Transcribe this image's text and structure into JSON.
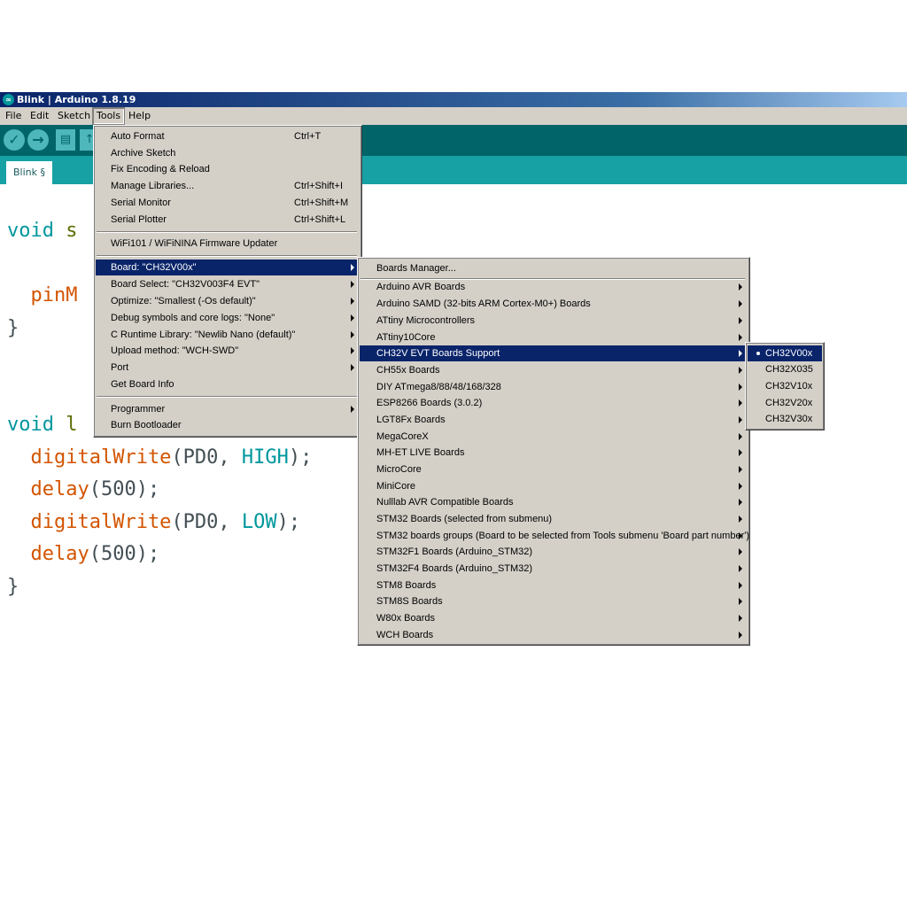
{
  "window": {
    "title": "Blink | Arduino 1.8.19",
    "icon": "arduino-infinity-icon"
  },
  "menubar": [
    {
      "label": "File"
    },
    {
      "label": "Edit"
    },
    {
      "label": "Sketch"
    },
    {
      "label": "Tools"
    },
    {
      "label": "Help"
    }
  ],
  "toolbar": {
    "verify": "verify-icon",
    "upload": "upload-icon",
    "new": "new-icon",
    "open": "open-icon"
  },
  "tab": {
    "label": "Blink §"
  },
  "code": {
    "l1_a": "void",
    "l1_b": " s",
    "l2_a": "  pinM",
    "l3": "}",
    "l4_a": "void",
    "l4_b": " l",
    "l5_a": "  digitalWrite",
    "l5_b": "(PD0, ",
    "l5_c": "HIGH",
    "l5_d": ");",
    "l6_a": "  delay",
    "l6_b": "(500);",
    "l7_a": "  digitalWrite",
    "l7_b": "(PD0, ",
    "l7_c": "LOW",
    "l7_d": ");",
    "l8_a": "  delay",
    "l8_b": "(500);",
    "l9": "}"
  },
  "tools_menu": {
    "items": [
      {
        "label": "Auto Format",
        "shortcut": "Ctrl+T"
      },
      {
        "label": "Archive Sketch",
        "shortcut": ""
      },
      {
        "label": "Fix Encoding & Reload",
        "shortcut": ""
      },
      {
        "label": "Manage Libraries...",
        "shortcut": "Ctrl+Shift+I"
      },
      {
        "label": "Serial Monitor",
        "shortcut": "Ctrl+Shift+M"
      },
      {
        "label": "Serial Plotter",
        "shortcut": "Ctrl+Shift+L"
      },
      {
        "label": "WiFi101 / WiFiNINA Firmware Updater",
        "shortcut": ""
      },
      {
        "label": "Board: \"CH32V00x\"",
        "shortcut": ""
      },
      {
        "label": "Board Select: \"CH32V003F4 EVT\"",
        "shortcut": ""
      },
      {
        "label": "Optimize: \"Smallest (-Os default)\"",
        "shortcut": ""
      },
      {
        "label": "Debug symbols and core logs: \"None\"",
        "shortcut": ""
      },
      {
        "label": "C Runtime Library: \"Newlib Nano (default)\"",
        "shortcut": ""
      },
      {
        "label": "Upload method: \"WCH-SWD\"",
        "shortcut": ""
      },
      {
        "label": "Port",
        "shortcut": ""
      },
      {
        "label": "Get Board Info",
        "shortcut": ""
      },
      {
        "label": "Programmer",
        "shortcut": ""
      },
      {
        "label": "Burn Bootloader",
        "shortcut": ""
      }
    ]
  },
  "board_menu": {
    "items": [
      {
        "label": "Boards Manager..."
      },
      {
        "label": "Arduino AVR Boards"
      },
      {
        "label": "Arduino SAMD (32-bits ARM Cortex-M0+) Boards"
      },
      {
        "label": "ATtiny Microcontrollers"
      },
      {
        "label": "ATtiny10Core"
      },
      {
        "label": "CH32V EVT Boards Support"
      },
      {
        "label": "CH55x Boards"
      },
      {
        "label": "DIY ATmega8/88/48/168/328"
      },
      {
        "label": "ESP8266 Boards (3.0.2)"
      },
      {
        "label": "LGT8Fx Boards"
      },
      {
        "label": "MegaCoreX"
      },
      {
        "label": "MH-ET LIVE Boards"
      },
      {
        "label": "MicroCore"
      },
      {
        "label": "MiniCore"
      },
      {
        "label": "Nulllab AVR Compatible Boards"
      },
      {
        "label": "STM32 Boards (selected from submenu)"
      },
      {
        "label": "STM32 boards groups (Board to be selected from Tools submenu 'Board part number')"
      },
      {
        "label": "STM32F1 Boards (Arduino_STM32)"
      },
      {
        "label": "STM32F4 Boards (Arduino_STM32)"
      },
      {
        "label": "STM8 Boards"
      },
      {
        "label": "STM8S Boards"
      },
      {
        "label": "W80x Boards"
      },
      {
        "label": "WCH Boards"
      }
    ]
  },
  "ch32v_menu": {
    "items": [
      {
        "label": "CH32V00x"
      },
      {
        "label": "CH32X035"
      },
      {
        "label": "CH32V10x"
      },
      {
        "label": "CH32V20x"
      },
      {
        "label": "CH32V30x"
      }
    ]
  },
  "colors": {
    "toolbar": "#006468",
    "tabbar": "#17a1a5",
    "menu_bg": "#d4d0c8",
    "selection": "#0a246a",
    "keyword": "#00979d",
    "function": "#d35400"
  }
}
